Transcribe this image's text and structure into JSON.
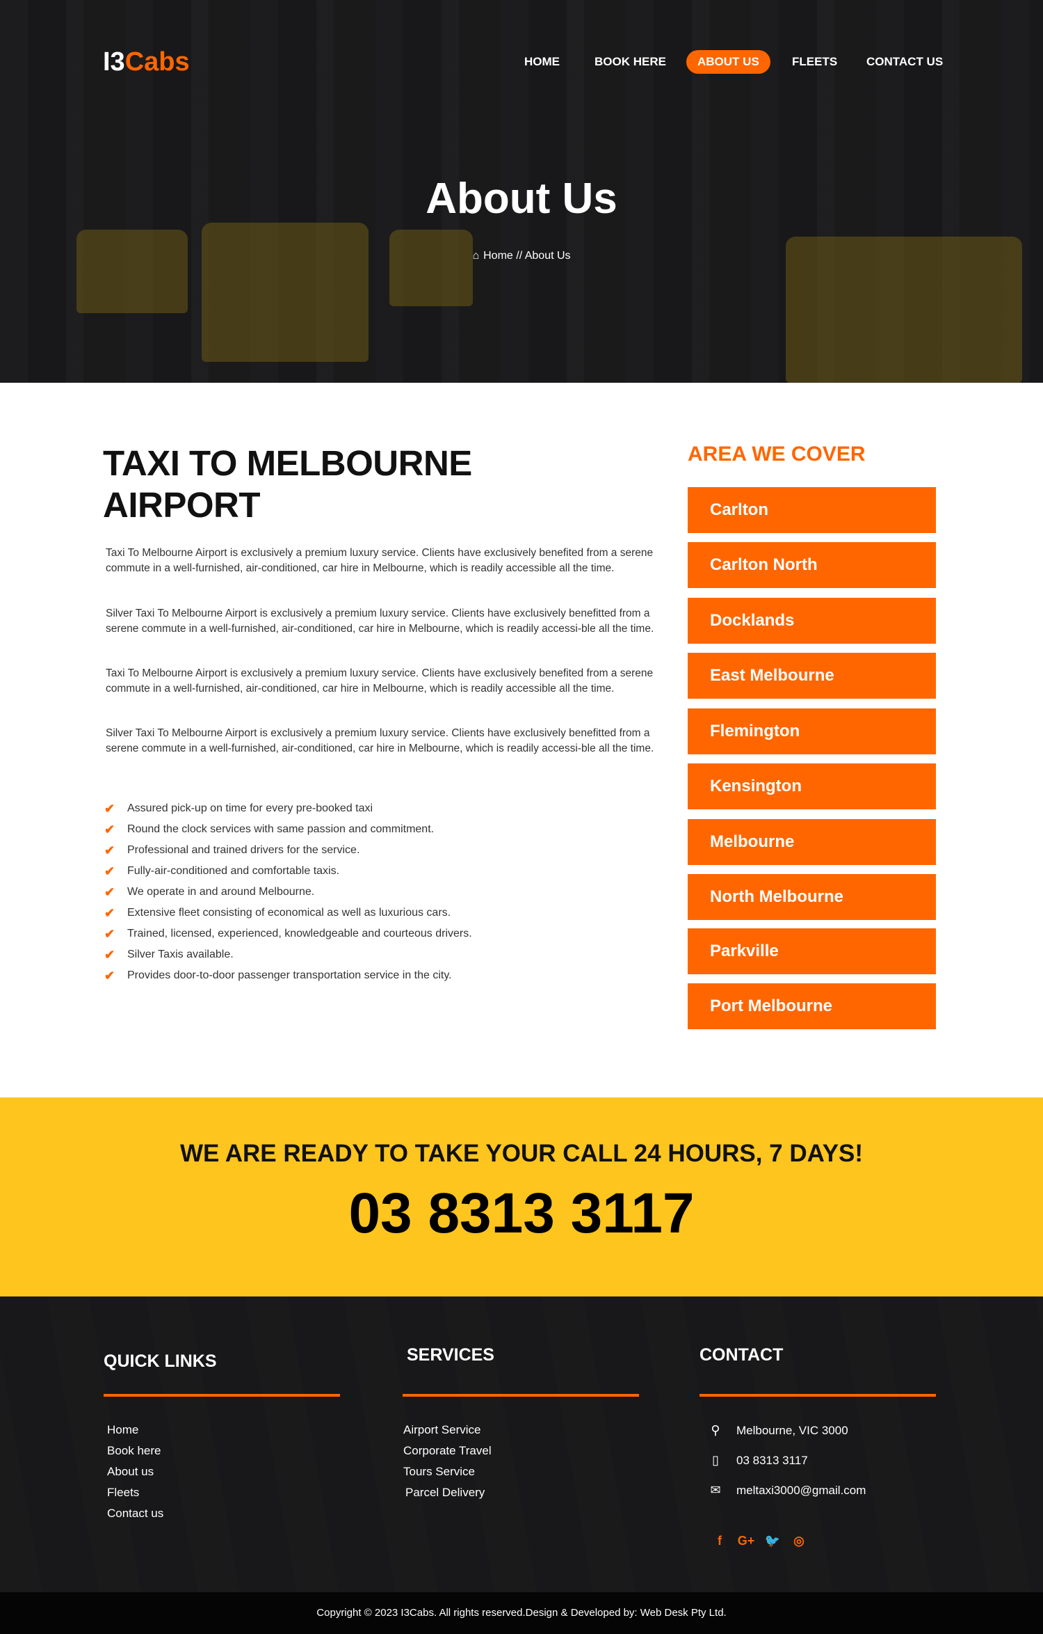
{
  "header": {
    "logo_main": "I3",
    "logo_accent": "Cabs",
    "nav": [
      {
        "label": "HOME"
      },
      {
        "label": "BOOK HERE"
      },
      {
        "label": "ABOUT US"
      },
      {
        "label": "FLEETS"
      },
      {
        "label": "CONTACT US"
      }
    ],
    "active_nav": "ABOUT US"
  },
  "hero": {
    "title": "About Us",
    "breadcrumb_home": "Home",
    "breadcrumb_sep": "//",
    "breadcrumb_current": "About Us"
  },
  "main": {
    "title": "TAXI TO MELBOURNE AIRPORT",
    "paragraphs": [
      "Taxi To Melbourne Airport is exclusively a premium luxury service. Clients have exclusively benefited from a serene commute in a well-furnished, air-conditioned, car hire in Melbourne, which is readily accessible all the time.",
      "Silver Taxi To Melbourne Airport is exclusively a premium luxury service. Clients have exclusively benefitted from a serene commute in a well-furnished, air-conditioned, car hire in Melbourne, which is readily accessi-ble all the time.",
      "Taxi To Melbourne Airport is exclusively a premium luxury service. Clients have exclusively benefited from a serene commute in a well-furnished, air-conditioned, car hire in Melbourne, which is readily accessible all the time.",
      "Silver Taxi To Melbourne Airport is exclusively a premium luxury service. Clients have exclusively benefitted from a serene commute in a well-furnished, air-conditioned, car hire in Melbourne, which is readily accessi-ble all the time."
    ],
    "features": [
      "Assured pick-up on time for every pre-booked taxi",
      "Round the clock services with same passion and commitment.",
      "Professional and trained drivers for the service.",
      "Fully-air-conditioned and comfortable taxis.",
      "We operate in and around Melbourne.",
      "Extensive fleet consisting of economical as well as luxurious cars.",
      "Trained, licensed, experienced, knowledgeable and courteous drivers.",
      "Silver Taxis available.",
      "Provides door-to-door passenger transportation service in the city."
    ]
  },
  "areas": {
    "title": "AREA WE COVER",
    "items": [
      "Carlton",
      "Carlton North",
      "Docklands",
      "East Melbourne",
      "Flemington",
      "Kensington",
      "Melbourne",
      "North Melbourne",
      "Parkville",
      "Port Melbourne"
    ]
  },
  "cta": {
    "headline": "WE ARE READY TO TAKE YOUR CALL 24 HOURS, 7 DAYS!",
    "phone": "03 8313 3117"
  },
  "footer": {
    "quick_links_title": "QUICK LINKS",
    "quick_links": [
      "Home",
      "Book here",
      "About us",
      "Fleets",
      "Contact us"
    ],
    "services_title": "SERVICES",
    "services": [
      "Airport Service",
      "Corporate Travel",
      "Tours Service",
      "Parcel Delivery"
    ],
    "contact_title": "CONTACT",
    "contact": [
      {
        "icon": "map-marker-icon",
        "text": "Melbourne, VIC 3000"
      },
      {
        "icon": "mobile-phone-icon",
        "text": "03 8313 3117"
      },
      {
        "icon": "envelope-icon",
        "text": "meltaxi3000@gmail.com"
      }
    ],
    "socials": [
      "facebook-icon",
      "google-plus-icon",
      "twitter-icon",
      "instagram-icon"
    ],
    "copyright": "Copyright © 2023 I3Cabs. All rights reserved.Design & Developed by: Web Desk Pty Ltd."
  },
  "colors": {
    "accent": "#ff6600",
    "cta_background": "#fdc51d",
    "dark": "#1a1a1a"
  }
}
